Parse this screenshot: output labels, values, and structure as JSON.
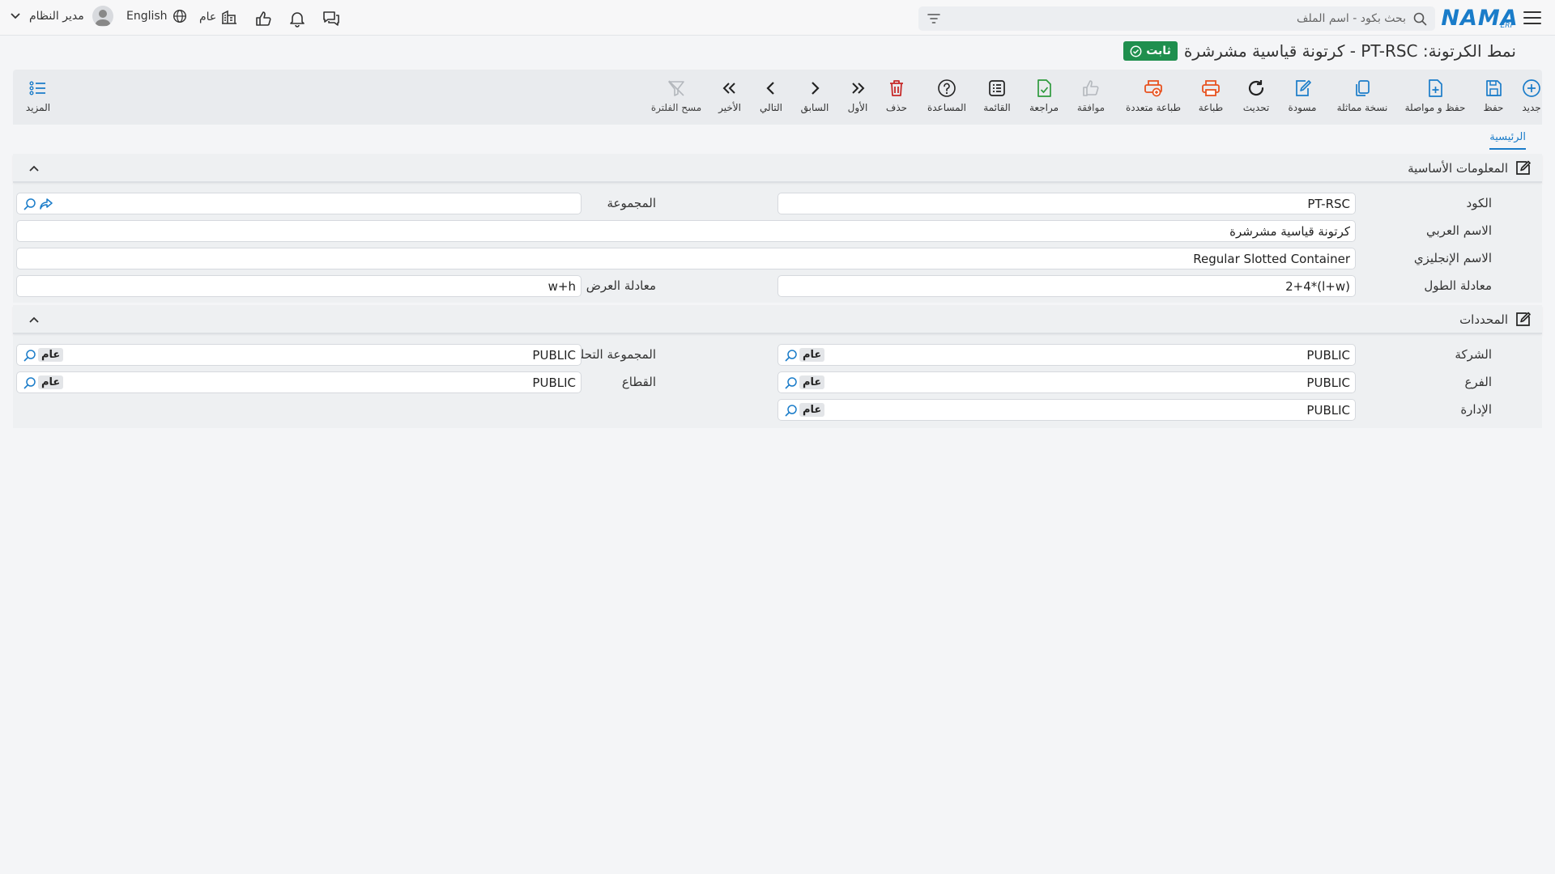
{
  "topbar": {
    "logo": "NAMA",
    "logo_sub": "ERP",
    "search_placeholder": "بحث بكود - اسم الملف",
    "language": "English",
    "public": "عام",
    "user_name": "مدير النظام"
  },
  "title": {
    "text": "نمط الكرتونة: PT-RSC - كرتونة قياسية مشرشرة",
    "status": "ثابت"
  },
  "toolbar": {
    "new": "جديد",
    "save": "حفظ",
    "save_continue": "حفظ و مواصلة",
    "duplicate": "نسخة مماثلة",
    "draft": "مسودة",
    "refresh": "تحديث",
    "print": "طباعة",
    "multi_print": "طباعة متعددة",
    "approve": "موافقة",
    "review": "مراجعة",
    "list": "القائمة",
    "help": "المساعدة",
    "delete": "حذف",
    "first": "الأول",
    "previous": "السابق",
    "next": "التالي",
    "last": "الأخير",
    "clear_filter": "مسح الفلترة",
    "more": "المزيد"
  },
  "tabs": {
    "main": "الرئيسية"
  },
  "basic_info": {
    "title": "المعلومات الأساسية",
    "code_label": "الكود",
    "code_value": "PT-RSC",
    "group_label": "المجموعة",
    "group_value": "",
    "arabic_name_label": "الاسم العربي",
    "arabic_name_value": "كرتونة قياسية مشرشرة",
    "english_name_label": "الاسم الإنجليزي",
    "english_name_value": "Regular Slotted Container",
    "length_eq_label": "معادلة الطول",
    "length_eq_value": "2+4*(l+w)",
    "width_eq_label": "معادلة العرض",
    "width_eq_value": "w+h"
  },
  "dimensions": {
    "title": "المحددات",
    "company_label": "الشركة",
    "company_value": "PUBLIC",
    "company_chip": "عام",
    "analysis_group_label": "المجموعة التحليلية",
    "analysis_group_value": "PUBLIC",
    "analysis_group_chip": "عام",
    "branch_label": "الفرع",
    "branch_value": "PUBLIC",
    "branch_chip": "عام",
    "sector_label": "القطاع",
    "sector_value": "PUBLIC",
    "sector_chip": "عام",
    "department_label": "الإدارة",
    "department_value": "PUBLIC",
    "department_chip": "عام"
  },
  "colors": {
    "accent": "#1a7cc9",
    "status_green": "#1f8f4e",
    "print_orange": "#e8521f",
    "delete_red": "#c62828",
    "review_green": "#2e9a3d"
  }
}
